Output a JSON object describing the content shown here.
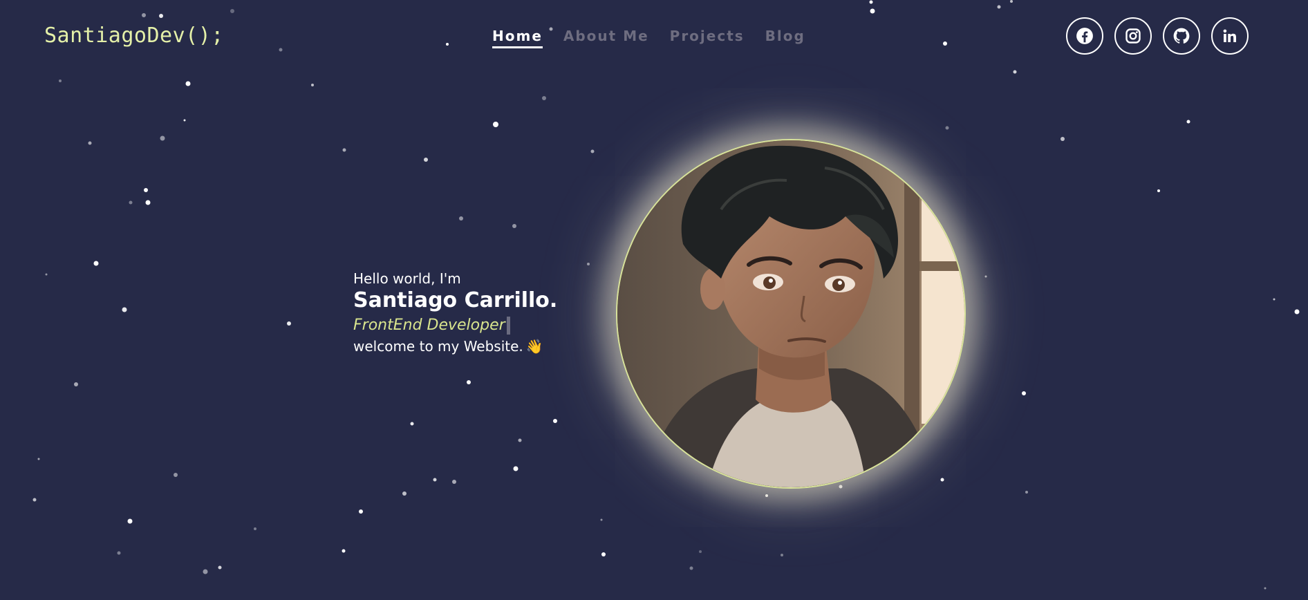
{
  "header": {
    "logo": "SantiagoDev();",
    "nav": [
      {
        "label": "Home",
        "active": true
      },
      {
        "label": "About Me",
        "active": false
      },
      {
        "label": "Projects",
        "active": false
      },
      {
        "label": "Blog",
        "active": false
      }
    ],
    "socials": [
      {
        "icon": "facebook-icon"
      },
      {
        "icon": "instagram-icon"
      },
      {
        "icon": "github-icon"
      },
      {
        "icon": "linkedin-icon"
      }
    ]
  },
  "hero": {
    "greeting": "Hello world, I'm",
    "name": "Santiago Carrillo.",
    "role": "FrontEnd Developer",
    "welcome": "welcome to my Website.",
    "welcome_icon": "👋"
  },
  "colors": {
    "background": "#262a48",
    "logo": "#e4f0a8",
    "accent": "#d9e58e",
    "nav_inactive": "#6e6d80"
  },
  "portrait": {
    "icon": "profile-avatar-illustration"
  }
}
